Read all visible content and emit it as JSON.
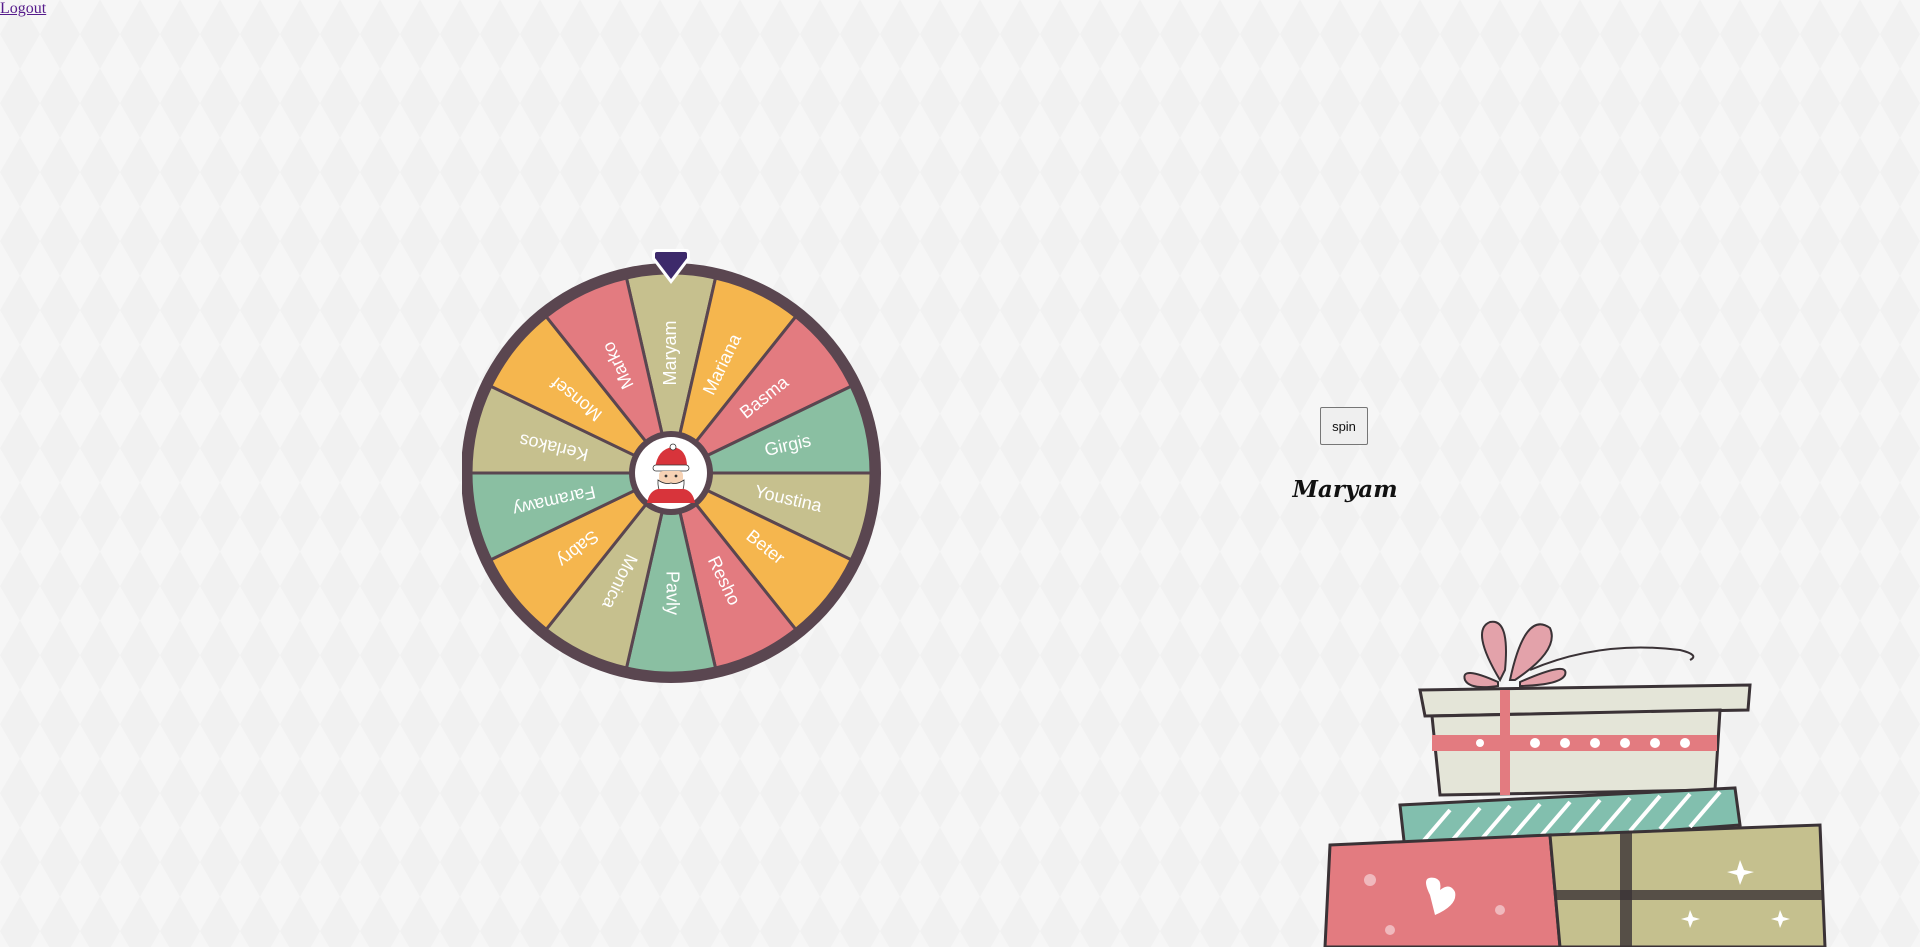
{
  "header": {
    "logout_label": "Logout"
  },
  "wheel": {
    "pointer_color": "#3d2a6b",
    "rim_color": "#5a4650",
    "center_icon": "santa-icon",
    "segments": [
      {
        "label": "Maryam",
        "color": "#c6c08e"
      },
      {
        "label": "Mariana",
        "color": "#f5b64e"
      },
      {
        "label": "Basma",
        "color": "#e37b80"
      },
      {
        "label": "Girgis",
        "color": "#8abfa2"
      },
      {
        "label": "Youstina",
        "color": "#c6c08e"
      },
      {
        "label": "Beter",
        "color": "#f5b64e"
      },
      {
        "label": "Resho",
        "color": "#e37b80"
      },
      {
        "label": "Pavly",
        "color": "#8abfa2"
      },
      {
        "label": "Monica",
        "color": "#c6c08e"
      },
      {
        "label": "Sabry",
        "color": "#f5b64e"
      },
      {
        "label": "Faramawy",
        "color": "#8abfa2"
      },
      {
        "label": "Kerlakos",
        "color": "#c6c08e"
      },
      {
        "label": "Monsef",
        "color": "#f5b64e"
      },
      {
        "label": "Marko",
        "color": "#e37b80"
      }
    ]
  },
  "controls": {
    "spin_label": "spin"
  },
  "result": {
    "winner_name": "Maryam"
  },
  "illustration": {
    "name": "gift-boxes-illustration"
  }
}
